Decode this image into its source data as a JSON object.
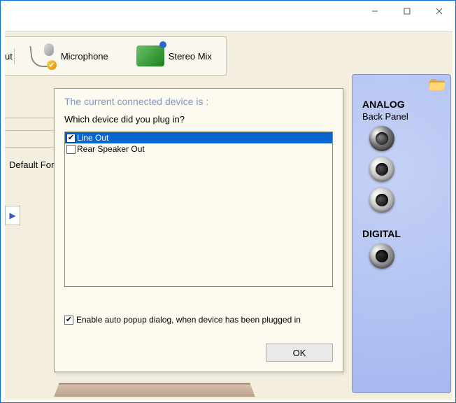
{
  "toolbar": {
    "truncated_label": "ut",
    "microphone_label": "Microphone",
    "stereomix_label": "Stereo Mix"
  },
  "left": {
    "default_format_label": "Default For"
  },
  "right_panel": {
    "analog_heading": "ANALOG",
    "analog_sub": "Back Panel",
    "digital_heading": "DIGITAL"
  },
  "dialog": {
    "title": "The current connected device is :",
    "question": "Which device did you plug in?",
    "devices": [
      {
        "label": "Line Out",
        "checked": true,
        "selected": true
      },
      {
        "label": "Rear Speaker Out",
        "checked": false,
        "selected": false
      }
    ],
    "auto_popup_label": "Enable auto popup dialog, when device has been plugged in",
    "auto_popup_checked": true,
    "ok_label": "OK"
  }
}
